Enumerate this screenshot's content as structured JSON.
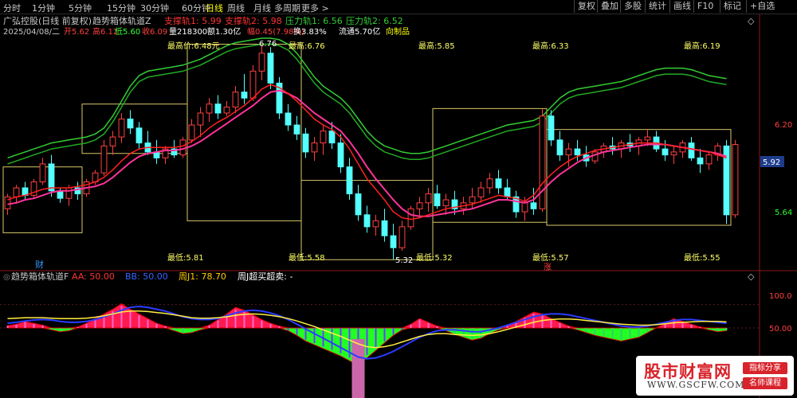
{
  "toolbar": {
    "timeframes": [
      "分时",
      "1分钟",
      "5分钟",
      "15分钟",
      "30分钟",
      "60分钟",
      "日线",
      "周线",
      "月线",
      "多周期",
      "更多 >"
    ],
    "active_timeframe": "日线",
    "buttons": [
      "复权",
      "叠加",
      "多股",
      "统计",
      "画线",
      "F10",
      "标记",
      "+自选"
    ]
  },
  "main_panel": {
    "stock_name": "广弘控股(日线 前复权)",
    "indicator_name": "趋势箱体轨道Z",
    "indicator_values": [
      {
        "label": "支撑轨1: 5.99",
        "color": "#ff3333"
      },
      {
        "label": "支撑轨2: 5.98",
        "color": "#ff3333"
      },
      {
        "label": "压力轨1: 6.56",
        "color": "#33cc33"
      },
      {
        "label": "压力轨2: 6.52",
        "color": "#33cc33"
      }
    ],
    "quote": {
      "date": "2025/04/08/二",
      "open": "开5.62",
      "high": "高6.12",
      "low": "低5.60",
      "close": "收6.09",
      "volume": "量218300",
      "amount": "额1.30亿",
      "change": "幅0.45(7.98%)",
      "turnover": "换3.83%",
      "float": "流通5.70亿",
      "custom": "向制品"
    },
    "annotations": {
      "max_price": "最高价:6.48元",
      "peak_label": "6.76",
      "trough_label": "5.32",
      "box_highs": [
        "最高:6.76",
        "最高:5.85",
        "最高:6.33",
        "最高:6.19"
      ],
      "box_lows": [
        "最低:5.81",
        "最低:5.58",
        "最低:5.32",
        "最低:5.57",
        "最低:5.55"
      ],
      "marker_cai": "财",
      "marker_zhang": "涨"
    },
    "price_axis": {
      "ticks": [
        "6.20",
        "5.64"
      ],
      "current_price": "5.92"
    }
  },
  "sub_panel": {
    "indicator_name": "趋势箱体轨道F",
    "values": [
      {
        "label": "AA: 50.00",
        "color": "#ff3333"
      },
      {
        "label": "BB: 50.00",
        "color": "#3366ff"
      },
      {
        "label": "周J1: 78.70",
        "color": "#ffcc00"
      },
      {
        "label": "周J超买超卖: -",
        "color": "#ffffff"
      }
    ],
    "axis_ticks": [
      "100.0",
      "50.00"
    ]
  },
  "brand": {
    "name": "股市财富网",
    "url": "WWW.GSCFW.COM",
    "tag1": "指标分享",
    "tag2": "名师课程"
  },
  "chart_data": {
    "type": "candlestick",
    "ylim": [
      5.3,
      6.8
    ],
    "candles": [
      {
        "o": 5.66,
        "h": 5.76,
        "l": 5.62,
        "c": 5.74
      },
      {
        "o": 5.74,
        "h": 5.82,
        "l": 5.7,
        "c": 5.8
      },
      {
        "o": 5.8,
        "h": 5.84,
        "l": 5.72,
        "c": 5.75
      },
      {
        "o": 5.75,
        "h": 5.86,
        "l": 5.73,
        "c": 5.84
      },
      {
        "o": 5.84,
        "h": 6.0,
        "l": 5.82,
        "c": 5.96
      },
      {
        "o": 5.96,
        "h": 6.02,
        "l": 5.74,
        "c": 5.78
      },
      {
        "o": 5.78,
        "h": 5.8,
        "l": 5.7,
        "c": 5.73
      },
      {
        "o": 5.73,
        "h": 5.82,
        "l": 5.68,
        "c": 5.8
      },
      {
        "o": 5.8,
        "h": 5.84,
        "l": 5.72,
        "c": 5.76
      },
      {
        "o": 5.76,
        "h": 5.86,
        "l": 5.74,
        "c": 5.84
      },
      {
        "o": 5.84,
        "h": 5.92,
        "l": 5.82,
        "c": 5.9
      },
      {
        "o": 5.9,
        "h": 6.12,
        "l": 5.88,
        "c": 6.08
      },
      {
        "o": 6.08,
        "h": 6.18,
        "l": 6.02,
        "c": 6.14
      },
      {
        "o": 6.14,
        "h": 6.3,
        "l": 6.1,
        "c": 6.26
      },
      {
        "o": 6.26,
        "h": 6.32,
        "l": 6.16,
        "c": 6.2
      },
      {
        "o": 6.2,
        "h": 6.24,
        "l": 6.06,
        "c": 6.1
      },
      {
        "o": 6.1,
        "h": 6.18,
        "l": 6.02,
        "c": 6.04
      },
      {
        "o": 6.04,
        "h": 6.12,
        "l": 5.96,
        "c": 6.0
      },
      {
        "o": 6.0,
        "h": 6.08,
        "l": 5.96,
        "c": 6.06
      },
      {
        "o": 6.06,
        "h": 6.12,
        "l": 6.0,
        "c": 6.02
      },
      {
        "o": 6.02,
        "h": 6.14,
        "l": 6.0,
        "c": 6.12
      },
      {
        "o": 6.12,
        "h": 6.26,
        "l": 6.1,
        "c": 6.22
      },
      {
        "o": 6.22,
        "h": 6.34,
        "l": 6.14,
        "c": 6.3
      },
      {
        "o": 6.3,
        "h": 6.4,
        "l": 6.24,
        "c": 6.36
      },
      {
        "o": 6.36,
        "h": 6.42,
        "l": 6.26,
        "c": 6.3
      },
      {
        "o": 6.3,
        "h": 6.38,
        "l": 6.28,
        "c": 6.34
      },
      {
        "o": 6.34,
        "h": 6.48,
        "l": 6.3,
        "c": 6.44
      },
      {
        "o": 6.44,
        "h": 6.56,
        "l": 6.36,
        "c": 6.4
      },
      {
        "o": 6.4,
        "h": 6.62,
        "l": 6.38,
        "c": 6.58
      },
      {
        "o": 6.58,
        "h": 6.76,
        "l": 6.52,
        "c": 6.7
      },
      {
        "o": 6.7,
        "h": 6.74,
        "l": 6.46,
        "c": 6.5
      },
      {
        "o": 6.5,
        "h": 6.54,
        "l": 6.26,
        "c": 6.3
      },
      {
        "o": 6.3,
        "h": 6.36,
        "l": 6.18,
        "c": 6.22
      },
      {
        "o": 6.22,
        "h": 6.28,
        "l": 6.12,
        "c": 6.16
      },
      {
        "o": 6.16,
        "h": 6.2,
        "l": 6.0,
        "c": 6.04
      },
      {
        "o": 6.04,
        "h": 6.14,
        "l": 5.98,
        "c": 6.1
      },
      {
        "o": 6.1,
        "h": 6.22,
        "l": 6.02,
        "c": 6.18
      },
      {
        "o": 6.18,
        "h": 6.24,
        "l": 6.06,
        "c": 6.1
      },
      {
        "o": 6.1,
        "h": 6.16,
        "l": 5.9,
        "c": 5.94
      },
      {
        "o": 5.94,
        "h": 6.0,
        "l": 5.72,
        "c": 5.76
      },
      {
        "o": 5.76,
        "h": 5.82,
        "l": 5.58,
        "c": 5.62
      },
      {
        "o": 5.62,
        "h": 5.68,
        "l": 5.5,
        "c": 5.54
      },
      {
        "o": 5.54,
        "h": 5.62,
        "l": 5.48,
        "c": 5.58
      },
      {
        "o": 5.58,
        "h": 5.66,
        "l": 5.44,
        "c": 5.48
      },
      {
        "o": 5.48,
        "h": 5.56,
        "l": 5.32,
        "c": 5.4
      },
      {
        "o": 5.4,
        "h": 5.58,
        "l": 5.38,
        "c": 5.54
      },
      {
        "o": 5.54,
        "h": 5.68,
        "l": 5.52,
        "c": 5.66
      },
      {
        "o": 5.66,
        "h": 5.74,
        "l": 5.6,
        "c": 5.7
      },
      {
        "o": 5.7,
        "h": 5.8,
        "l": 5.64,
        "c": 5.76
      },
      {
        "o": 5.76,
        "h": 5.82,
        "l": 5.66,
        "c": 5.68
      },
      {
        "o": 5.68,
        "h": 5.76,
        "l": 5.62,
        "c": 5.72
      },
      {
        "o": 5.72,
        "h": 5.78,
        "l": 5.62,
        "c": 5.66
      },
      {
        "o": 5.66,
        "h": 5.74,
        "l": 5.62,
        "c": 5.7
      },
      {
        "o": 5.7,
        "h": 5.8,
        "l": 5.66,
        "c": 5.74
      },
      {
        "o": 5.74,
        "h": 5.84,
        "l": 5.7,
        "c": 5.8
      },
      {
        "o": 5.8,
        "h": 5.9,
        "l": 5.76,
        "c": 5.86
      },
      {
        "o": 5.86,
        "h": 5.92,
        "l": 5.76,
        "c": 5.8
      },
      {
        "o": 5.8,
        "h": 5.86,
        "l": 5.72,
        "c": 5.74
      },
      {
        "o": 5.74,
        "h": 5.78,
        "l": 5.6,
        "c": 5.64
      },
      {
        "o": 5.64,
        "h": 5.74,
        "l": 5.58,
        "c": 5.7
      },
      {
        "o": 5.7,
        "h": 5.8,
        "l": 5.62,
        "c": 5.66
      },
      {
        "o": 5.66,
        "h": 6.33,
        "l": 5.64,
        "c": 6.28
      },
      {
        "o": 6.28,
        "h": 6.32,
        "l": 6.08,
        "c": 6.12
      },
      {
        "o": 6.12,
        "h": 6.18,
        "l": 5.98,
        "c": 6.02
      },
      {
        "o": 6.02,
        "h": 6.1,
        "l": 5.94,
        "c": 6.06
      },
      {
        "o": 6.06,
        "h": 6.12,
        "l": 5.98,
        "c": 6.02
      },
      {
        "o": 6.02,
        "h": 6.08,
        "l": 5.94,
        "c": 5.98
      },
      {
        "o": 5.98,
        "h": 6.06,
        "l": 5.96,
        "c": 6.04
      },
      {
        "o": 6.04,
        "h": 6.1,
        "l": 6.0,
        "c": 6.08
      },
      {
        "o": 6.08,
        "h": 6.14,
        "l": 6.02,
        "c": 6.06
      },
      {
        "o": 6.06,
        "h": 6.12,
        "l": 6.0,
        "c": 6.1
      },
      {
        "o": 6.1,
        "h": 6.16,
        "l": 6.04,
        "c": 6.08
      },
      {
        "o": 6.08,
        "h": 6.14,
        "l": 6.02,
        "c": 6.12
      },
      {
        "o": 6.12,
        "h": 6.19,
        "l": 6.08,
        "c": 6.14
      },
      {
        "o": 6.14,
        "h": 6.18,
        "l": 6.04,
        "c": 6.06
      },
      {
        "o": 6.06,
        "h": 6.12,
        "l": 5.98,
        "c": 6.02
      },
      {
        "o": 6.02,
        "h": 6.08,
        "l": 5.96,
        "c": 6.04
      },
      {
        "o": 6.04,
        "h": 6.12,
        "l": 6.0,
        "c": 6.1
      },
      {
        "o": 6.1,
        "h": 6.14,
        "l": 5.98,
        "c": 6.0
      },
      {
        "o": 6.0,
        "h": 6.06,
        "l": 5.9,
        "c": 5.96
      },
      {
        "o": 5.96,
        "h": 6.04,
        "l": 5.92,
        "c": 6.02
      },
      {
        "o": 6.02,
        "h": 6.1,
        "l": 5.98,
        "c": 6.08
      },
      {
        "o": 6.08,
        "h": 6.12,
        "l": 5.56,
        "c": 5.62
      },
      {
        "o": 5.62,
        "h": 6.12,
        "l": 5.6,
        "c": 6.09
      }
    ],
    "ma_red": [
      5.72,
      5.74,
      5.75,
      5.77,
      5.79,
      5.8,
      5.8,
      5.8,
      5.81,
      5.82,
      5.84,
      5.87,
      5.92,
      5.98,
      6.03,
      6.06,
      6.07,
      6.07,
      6.07,
      6.07,
      6.08,
      6.11,
      6.15,
      6.2,
      6.24,
      6.27,
      6.31,
      6.35,
      6.4,
      6.46,
      6.49,
      6.47,
      6.43,
      6.38,
      6.32,
      6.26,
      6.22,
      6.19,
      6.14,
      6.06,
      5.96,
      5.86,
      5.79,
      5.72,
      5.64,
      5.6,
      5.59,
      5.6,
      5.62,
      5.64,
      5.66,
      5.67,
      5.68,
      5.69,
      5.71,
      5.73,
      5.75,
      5.74,
      5.73,
      5.71,
      5.75,
      5.83,
      5.89,
      5.94,
      5.98,
      6.01,
      6.03,
      6.05,
      6.06,
      6.07,
      6.08,
      6.09,
      6.1,
      6.1,
      6.1,
      6.09,
      6.08,
      6.07,
      6.06,
      6.05,
      6.04,
      6.02,
      6.0
    ],
    "ma_pink": [
      5.69,
      5.7,
      5.72,
      5.73,
      5.75,
      5.77,
      5.78,
      5.78,
      5.79,
      5.8,
      5.81,
      5.83,
      5.87,
      5.92,
      5.97,
      6.01,
      6.03,
      6.04,
      6.05,
      6.05,
      6.06,
      6.08,
      6.11,
      6.15,
      6.19,
      6.23,
      6.27,
      6.31,
      6.35,
      6.4,
      6.44,
      6.45,
      6.43,
      6.4,
      6.35,
      6.3,
      6.26,
      6.22,
      6.18,
      6.11,
      6.03,
      5.94,
      5.86,
      5.79,
      5.72,
      5.66,
      5.62,
      5.61,
      5.61,
      5.62,
      5.63,
      5.64,
      5.65,
      5.66,
      5.68,
      5.7,
      5.72,
      5.72,
      5.71,
      5.7,
      5.72,
      5.78,
      5.84,
      5.89,
      5.93,
      5.97,
      6.0,
      6.02,
      6.04,
      6.05,
      6.06,
      6.07,
      6.08,
      6.09,
      6.09,
      6.09,
      6.08,
      6.07,
      6.06,
      6.05,
      6.04,
      6.03,
      6.01
    ],
    "band_upper": [
      6.0,
      6.02,
      6.04,
      6.06,
      6.08,
      6.1,
      6.11,
      6.12,
      6.13,
      6.14,
      6.16,
      6.2,
      6.28,
      6.38,
      6.48,
      6.55,
      6.58,
      6.59,
      6.6,
      6.61,
      6.62,
      6.64,
      6.66,
      6.69,
      6.72,
      6.75,
      6.77,
      6.78,
      6.79,
      6.8,
      6.8,
      6.79,
      6.76,
      6.7,
      6.62,
      6.54,
      6.48,
      6.44,
      6.4,
      6.34,
      6.26,
      6.18,
      6.12,
      6.08,
      6.06,
      6.04,
      6.03,
      6.03,
      6.04,
      6.06,
      6.08,
      6.1,
      6.12,
      6.14,
      6.16,
      6.18,
      6.2,
      6.22,
      6.23,
      6.24,
      6.25,
      6.28,
      6.34,
      6.4,
      6.44,
      6.46,
      6.47,
      6.48,
      6.49,
      6.5,
      6.51,
      6.53,
      6.55,
      6.57,
      6.59,
      6.6,
      6.6,
      6.6,
      6.59,
      6.57,
      6.55,
      6.54,
      6.53
    ],
    "band_lower": [
      5.96,
      5.98,
      6.0,
      6.02,
      6.04,
      6.06,
      6.07,
      6.08,
      6.09,
      6.1,
      6.12,
      6.16,
      6.24,
      6.34,
      6.44,
      6.51,
      6.54,
      6.55,
      6.56,
      6.57,
      6.58,
      6.6,
      6.62,
      6.65,
      6.68,
      6.71,
      6.73,
      6.74,
      6.75,
      6.76,
      6.76,
      6.75,
      6.72,
      6.66,
      6.58,
      6.5,
      6.44,
      6.4,
      6.36,
      6.3,
      6.22,
      6.14,
      6.08,
      6.04,
      6.02,
      6.0,
      5.99,
      5.99,
      6.0,
      6.02,
      6.04,
      6.06,
      6.08,
      6.1,
      6.12,
      6.14,
      6.16,
      6.18,
      6.19,
      6.2,
      6.21,
      6.24,
      6.3,
      6.36,
      6.4,
      6.42,
      6.43,
      6.44,
      6.45,
      6.46,
      6.47,
      6.49,
      6.51,
      6.53,
      6.55,
      6.56,
      6.56,
      6.56,
      6.55,
      6.53,
      6.51,
      6.5,
      6.49
    ],
    "boxes": [
      {
        "start": 0,
        "end": 8,
        "high": 5.94,
        "low": 5.5,
        "high_label": "",
        "low_label": "最低:5.81"
      },
      {
        "start": 9,
        "end": 20,
        "high": 6.36,
        "low": 6.03,
        "high_label": "最高价:6.48元",
        "low_label": ""
      },
      {
        "start": 21,
        "end": 33,
        "high": 6.76,
        "low": 5.58,
        "high_label": "最高:6.76",
        "low_label": "最低:5.58"
      },
      {
        "start": 34,
        "end": 48,
        "high": 5.85,
        "low": 5.32,
        "high_label": "最高:5.85",
        "low_label": "最低:5.32"
      },
      {
        "start": 49,
        "end": 61,
        "high": 6.33,
        "low": 5.57,
        "high_label": "最高:6.33",
        "low_label": "最低:5.57"
      },
      {
        "start": 62,
        "end": 82,
        "high": 6.19,
        "low": 5.55,
        "high_label": "最高:6.19",
        "low_label": "最低:5.55"
      }
    ],
    "osc_ylim": [
      -100,
      100
    ],
    "osc_values": [
      5,
      8,
      14,
      10,
      6,
      -4,
      -8,
      -6,
      2,
      10,
      20,
      30,
      40,
      52,
      40,
      30,
      20,
      10,
      4,
      -6,
      -12,
      -10,
      -4,
      6,
      18,
      30,
      44,
      38,
      28,
      18,
      10,
      4,
      -6,
      -16,
      -28,
      -36,
      -44,
      -52,
      -60,
      -70,
      -80,
      -64,
      -48,
      -32,
      -16,
      -4,
      8,
      20,
      12,
      4,
      -6,
      -14,
      -20,
      -26,
      -22,
      -12,
      -4,
      6,
      14,
      24,
      34,
      30,
      20,
      12,
      4,
      -4,
      -10,
      -16,
      -20,
      -24,
      -28,
      -24,
      -20,
      -10,
      0,
      10,
      20,
      14,
      8,
      2,
      -4,
      -8,
      -6
    ],
    "osc_yellow": [
      20,
      21,
      22,
      22,
      22,
      21,
      20,
      20,
      20,
      21,
      23,
      26,
      30,
      34,
      36,
      36,
      35,
      33,
      31,
      28,
      25,
      22,
      21,
      21,
      22,
      24,
      27,
      29,
      30,
      29,
      27,
      24,
      20,
      15,
      9,
      3,
      -4,
      -11,
      -18,
      -26,
      -34,
      -40,
      -42,
      -40,
      -36,
      -30,
      -24,
      -18,
      -14,
      -12,
      -12,
      -14,
      -15,
      -16,
      -15,
      -12,
      -8,
      -3,
      2,
      7,
      12,
      16,
      18,
      19,
      19,
      18,
      16,
      14,
      12,
      10,
      8,
      7,
      6,
      6,
      7,
      9,
      11,
      12,
      13,
      14,
      14,
      14,
      13
    ],
    "osc_blue": [
      10,
      12,
      15,
      17,
      18,
      17,
      14,
      12,
      12,
      14,
      18,
      24,
      30,
      38,
      44,
      46,
      44,
      40,
      36,
      30,
      24,
      20,
      18,
      18,
      20,
      26,
      32,
      36,
      38,
      36,
      32,
      26,
      18,
      8,
      -2,
      -12,
      -22,
      -32,
      -42,
      -52,
      -62,
      -66,
      -64,
      -58,
      -50,
      -40,
      -30,
      -20,
      -12,
      -6,
      -4,
      -4,
      -6,
      -8,
      -8,
      -4,
      0,
      6,
      12,
      18,
      24,
      28,
      30,
      30,
      28,
      24,
      20,
      16,
      12,
      8,
      4,
      2,
      2,
      4,
      8,
      12,
      16,
      18,
      18,
      16,
      14,
      12,
      10
    ]
  }
}
